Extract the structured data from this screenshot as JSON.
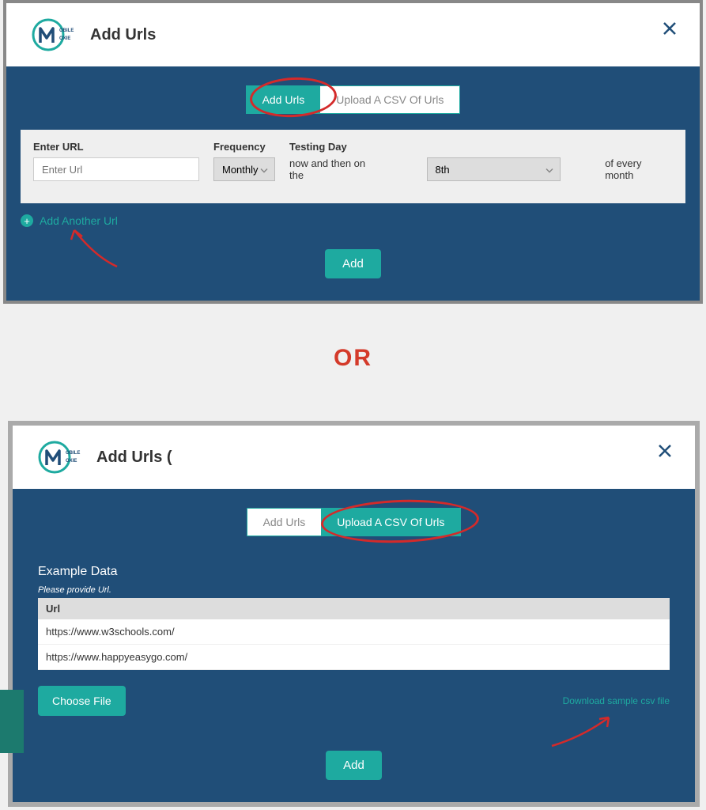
{
  "modal1": {
    "title": "Add Urls",
    "tabs": {
      "add_urls": "Add Urls",
      "upload_csv": "Upload A CSV Of Urls"
    },
    "form": {
      "url_label": "Enter URL",
      "url_placeholder": "Enter Url",
      "freq_label": "Frequency",
      "freq_value": "Monthly",
      "testing_label": "Testing Day",
      "testing_prefix": "now and then on the",
      "day_value": "8th",
      "testing_suffix": "of every month"
    },
    "add_another": "Add Another Url",
    "submit": "Add"
  },
  "divider": "OR",
  "modal2": {
    "title": "Add Urls (",
    "tabs": {
      "add_urls": "Add Urls",
      "upload_csv": "Upload A CSV Of Urls"
    },
    "example_heading": "Example Data",
    "example_sub": "Please provide Url.",
    "table_header": "Url",
    "rows": [
      "https://www.w3schools.com/",
      "https://www.happyeasygo.com/"
    ],
    "choose_file": "Choose File",
    "download_link": "Download sample csv file",
    "submit": "Add"
  }
}
